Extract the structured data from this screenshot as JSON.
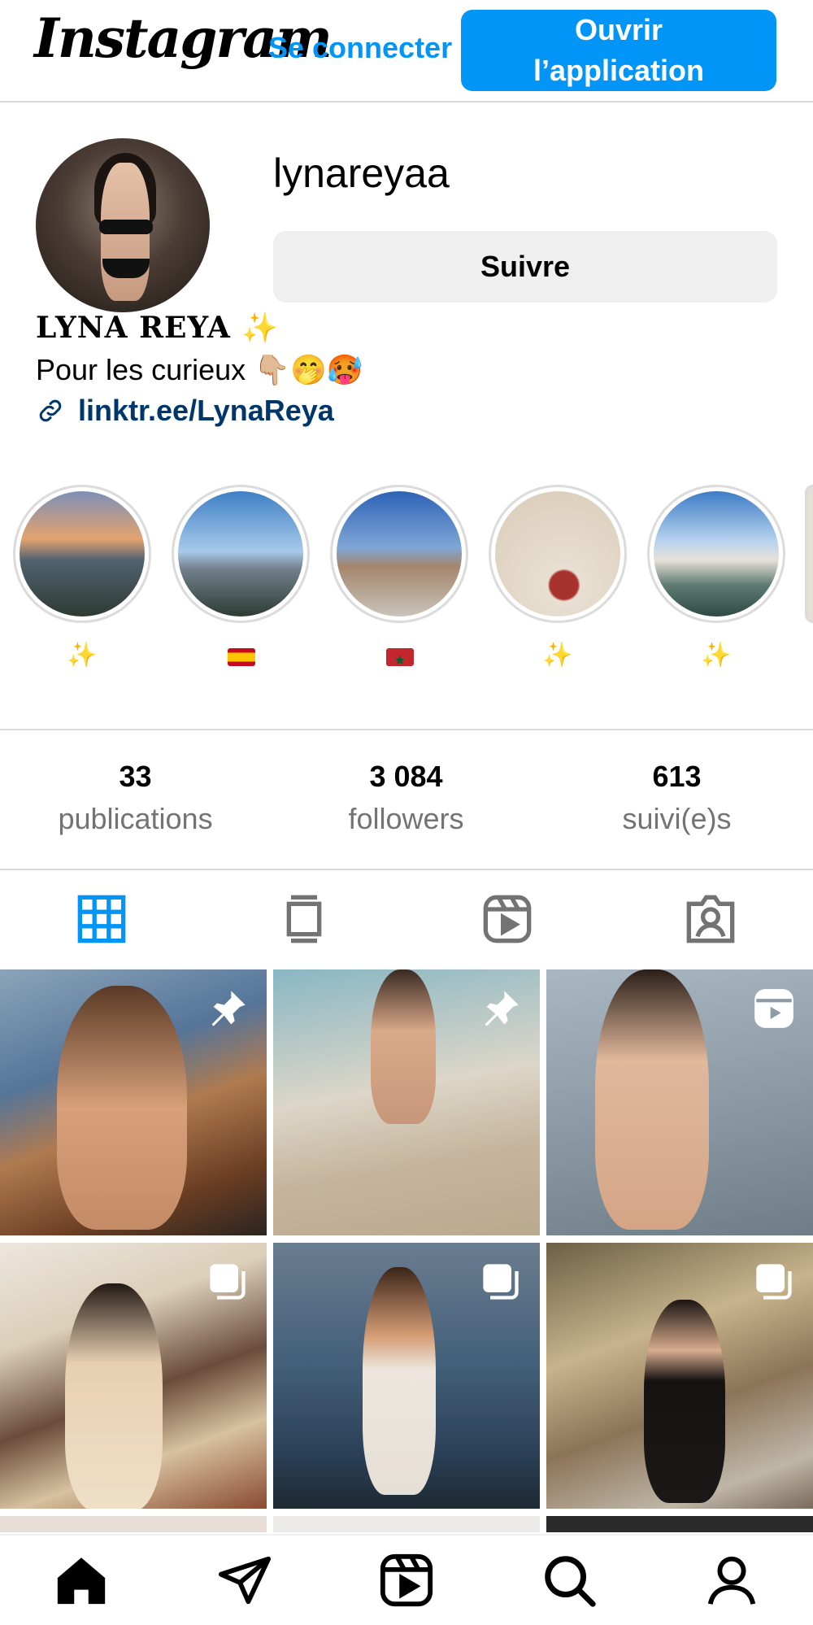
{
  "header": {
    "logo": "Instagram",
    "login_label": "Se connecter",
    "open_app_label": "Ouvrir l’application"
  },
  "profile": {
    "username": "lynareyaa",
    "follow_label": "Suivre",
    "full_name": "LYNA REYA ✨",
    "bio": "Pour les curieux 👇🏼🤭🥵",
    "link": "linktr.ee/LynaReya"
  },
  "highlights": [
    {
      "label": "✨"
    },
    {
      "label": "🇪🇸"
    },
    {
      "label": "🇲🇦"
    },
    {
      "label": "✨"
    },
    {
      "label": "✨"
    }
  ],
  "stats": {
    "posts": {
      "value": "33",
      "label": "publications"
    },
    "followers": {
      "value": "3 084",
      "label": "followers"
    },
    "following": {
      "value": "613",
      "label": "suivi(e)s"
    }
  },
  "tabs": [
    "grid-icon",
    "feed-icon",
    "reels-icon",
    "tagged-icon"
  ],
  "active_tab": "grid-icon",
  "posts": [
    {
      "badge": "pin-icon"
    },
    {
      "badge": "pin-icon"
    },
    {
      "badge": "reel-icon"
    },
    {
      "badge": "carousel-icon"
    },
    {
      "badge": "carousel-icon"
    },
    {
      "badge": "carousel-icon"
    }
  ],
  "bottom_nav": [
    "home-icon",
    "direct-icon",
    "reels-icon",
    "search-icon",
    "profile-icon"
  ],
  "colors": {
    "accent": "#0095f6",
    "link": "#00376b",
    "muted": "#737373",
    "divider": "#dbdbdb"
  }
}
